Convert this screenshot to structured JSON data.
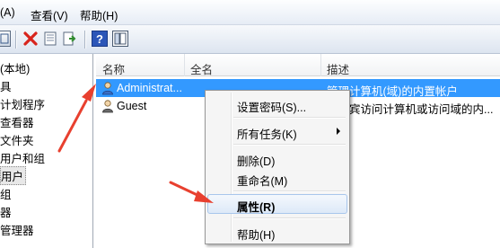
{
  "menubar": {
    "items": [
      {
        "label": "(A)"
      },
      {
        "label": "查看(V)"
      },
      {
        "label": "帮助(H)"
      }
    ]
  },
  "toolbar": {
    "icons": [
      "back-icon",
      "delete-icon",
      "properties-icon",
      "export-icon",
      "help-icon",
      "show-hide-pane-icon"
    ]
  },
  "tree": {
    "items": [
      {
        "label": "(本地)"
      },
      {
        "label": "具"
      },
      {
        "label": "计划程序"
      },
      {
        "label": "查看器"
      },
      {
        "label": "文件夹"
      },
      {
        "label": "用户和组"
      },
      {
        "label": "用户",
        "selected": true
      },
      {
        "label": "组"
      },
      {
        "label": "器"
      },
      {
        "label": "管理器"
      }
    ]
  },
  "list": {
    "columns": [
      {
        "label": "名称"
      },
      {
        "label": "全名"
      },
      {
        "label": "描述"
      }
    ],
    "rows": [
      {
        "name": "Administrat...",
        "fullname": "",
        "desc": "管理计算机(域)的内置帐户",
        "selected": true
      },
      {
        "name": "Guest",
        "fullname": "",
        "desc": "供来宾访问计算机或访问域的内..."
      }
    ]
  },
  "context_menu": {
    "items": [
      {
        "label": "设置密码(S)..."
      },
      {
        "label": "所有任务(K)",
        "submenu": true
      },
      {
        "label": "删除(D)"
      },
      {
        "label": "重命名(M)"
      },
      {
        "label": "属性(R)",
        "highlighted": true
      },
      {
        "label": "帮助(H)"
      }
    ]
  },
  "colors": {
    "selection": "#3399ff",
    "annotation_arrow": "#e8402f",
    "menu_highlight_border": "#a8c6ec"
  }
}
